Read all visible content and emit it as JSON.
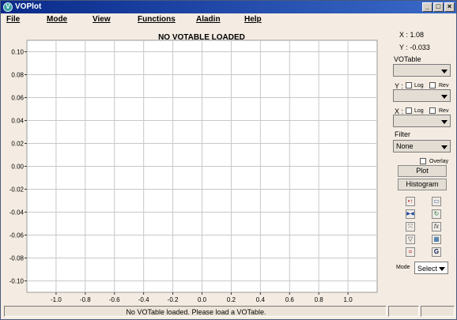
{
  "window": {
    "title": "VOPlot",
    "app_icon": "voplot-logo-icon",
    "buttons": {
      "minimize": "_",
      "maximize": "□",
      "close": "×"
    }
  },
  "menu": [
    "File",
    "Mode",
    "View",
    "Functions",
    "Aladin",
    "Help"
  ],
  "side": {
    "x_readout": "X : 1.08",
    "y_readout": "Y : -0.033",
    "votable_label": "VOTable",
    "votable_value": "",
    "y_axis_label": "Y :",
    "x_axis_label": "X :",
    "log_label": "Log",
    "rev_label": "Rev",
    "y_column_value": "",
    "x_column_value": "",
    "filter_label": "Filter",
    "filter_value": "None",
    "overlay_label": "Overlay",
    "plot_button": "Plot",
    "histogram_button": "Histogram",
    "mode_label": "Mode",
    "mode_value": "Select",
    "tools": [
      {
        "name": "marker-tool-icon",
        "glyph": "•↑"
      },
      {
        "name": "print-icon",
        "glyph": "▭"
      },
      {
        "name": "reset-arrows-icon",
        "glyph": "▶◀"
      },
      {
        "name": "refresh-icon",
        "glyph": "↻"
      },
      {
        "name": "zoom-fit-icon",
        "glyph": "⤧"
      },
      {
        "name": "function-fx-icon",
        "glyph": "fx"
      },
      {
        "name": "filter-funnel-icon",
        "glyph": "▽"
      },
      {
        "name": "table-grid-icon",
        "glyph": "▦"
      },
      {
        "name": "crop-icon",
        "glyph": "⌗"
      },
      {
        "name": "rotate-icon",
        "glyph": "G"
      }
    ]
  },
  "status": {
    "message": "No VOTable loaded. Please load a VOTable."
  },
  "chart_data": {
    "type": "scatter",
    "title": "NO VOTABLE LOADED",
    "series": [],
    "xlim": [
      -1.2,
      1.2
    ],
    "ylim": [
      -0.11,
      0.11
    ],
    "xticks": [
      "-1.0",
      "-0.8",
      "-0.6",
      "-0.4",
      "-0.2",
      "0.0",
      "0.2",
      "0.4",
      "0.6",
      "0.8",
      "1.0"
    ],
    "yticks": [
      "0.10",
      "0.08",
      "0.06",
      "0.04",
      "0.02",
      "0.00",
      "-0.02",
      "-0.04",
      "-0.06",
      "-0.08",
      "-0.10"
    ],
    "grid": true
  }
}
